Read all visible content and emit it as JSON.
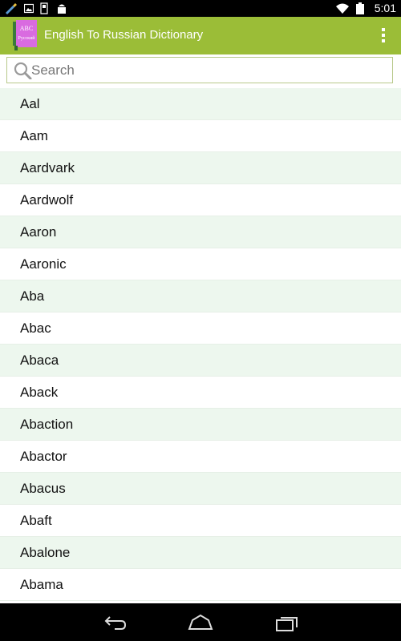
{
  "status_bar": {
    "time": "5:01",
    "icons": [
      "notification-app-icon",
      "image-icon",
      "sd-card-icon",
      "android-debug-icon",
      "wifi-icon",
      "battery-icon"
    ]
  },
  "action_bar": {
    "logo_line1": "ABC",
    "logo_line2": "Русский",
    "title": "English To Russian Dictionary",
    "menu_icon": "overflow-menu-icon",
    "color": "#9bbd37"
  },
  "search": {
    "placeholder": "Search",
    "value": ""
  },
  "word_list": {
    "items": [
      "Aal",
      "Aam",
      "Aardvark",
      "Aardwolf",
      "Aaron",
      "Aaronic",
      "Aba",
      "Abac",
      "Abaca",
      "Aback",
      "Abaction",
      "Abactor",
      "Abacus",
      "Abaft",
      "Abalone",
      "Abama"
    ],
    "odd_row_color": "#edf7ee",
    "even_row_color": "#ffffff"
  },
  "nav_bar": {
    "buttons": [
      "back-icon",
      "home-icon",
      "recent-apps-icon"
    ]
  }
}
